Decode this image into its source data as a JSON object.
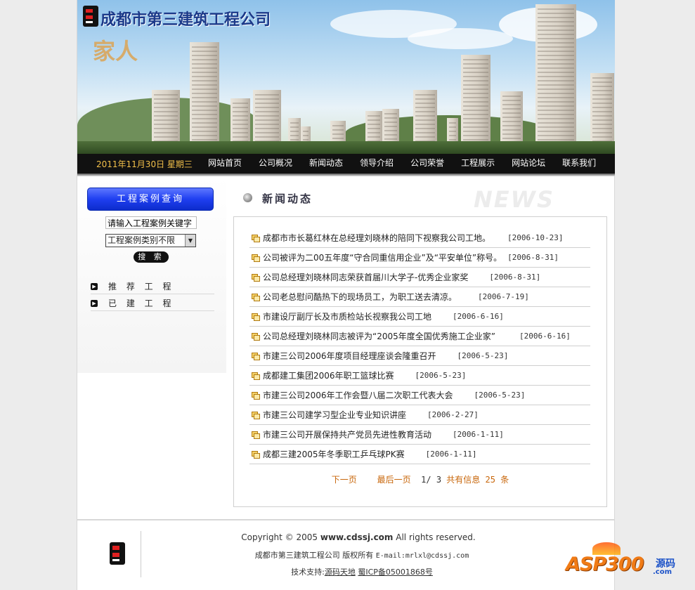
{
  "header": {
    "company_name": "成都市第三建筑工程公司",
    "slogan": "家人"
  },
  "nav": {
    "date": "2011年11月30日 星期三",
    "items": [
      "网站首页",
      "公司概况",
      "新闻动态",
      "领导介绍",
      "公司荣誉",
      "工程展示",
      "网站论坛",
      "联系我们"
    ]
  },
  "sidebar": {
    "case_query_label": "工程案例查询",
    "keyword_placeholder": "请输入工程案例关键字",
    "category_selected": "工程案例类别不限",
    "search_label": "搜 索",
    "links": [
      "推 荐 工 程",
      "已 建 工 程"
    ]
  },
  "main": {
    "section_title": "新闻动态",
    "section_title_en": "NEWS",
    "news": [
      {
        "title": "成都市市长葛红林在总经理刘晓林的陪同下视察我公司工地。",
        "date": "[2006-10-23]"
      },
      {
        "title": "公司被评为二00五年度“守合同重信用企业”及“平安单位”称号。",
        "date": "[2006-8-31]"
      },
      {
        "title": "公司总经理刘晓林同志荣获首届川大学子-优秀企业家奖",
        "date": "[2006-8-31]"
      },
      {
        "title": "公司老总慰问酷热下的现场员工，为职工送去清凉。",
        "date": "[2006-7-19]"
      },
      {
        "title": "市建设厅副厅长及市质检站长视察我公司工地",
        "date": "[2006-6-16]"
      },
      {
        "title": "公司总经理刘晓林同志被评为“2005年度全国优秀施工企业家”",
        "date": "[2006-6-16]"
      },
      {
        "title": "市建三公司2006年度项目经理座谈会隆重召开",
        "date": "[2006-5-23]"
      },
      {
        "title": "成都建工集团2006年职工篮球比赛",
        "date": "[2006-5-23]"
      },
      {
        "title": "市建三公司2006年工作会暨八届二次职工代表大会",
        "date": "[2006-5-23]"
      },
      {
        "title": "市建三公司建学习型企业专业知识讲座",
        "date": "[2006-2-27]"
      },
      {
        "title": "市建三公司开展保持共产党员先进性教育活动",
        "date": "[2006-1-11]"
      },
      {
        "title": "成都三建2005年冬季职工乒乓球PK赛",
        "date": "[2006-1-11]"
      }
    ],
    "pager": {
      "next": "下一页",
      "last": "最后一页",
      "current": "1",
      "total_pages": "3",
      "total_label": "共有信息",
      "total_count": "25",
      "unit": "条"
    }
  },
  "footer": {
    "copyright_prefix": "Copyright © 2005 ",
    "copyright_site": "www.cdssj.com",
    "copyright_suffix": " All rights reserved.",
    "owner": "成都市第三建筑工程公司 版权所有",
    "email": "E-mail:mrlxl@cdssj.com",
    "support_label": "技术支持:",
    "support_name": "源码天地",
    "icp": "蜀ICP备05001868号"
  },
  "watermark": {
    "brand": "ASP300",
    "cn": "源码",
    "domain": ".com"
  },
  "colors": {
    "nav_bg": "#111111",
    "nav_date": "#f2c04a",
    "case_button": "#1f3ff0",
    "pager_link": "#c8660a",
    "title_blue": "#1c3a8a"
  }
}
